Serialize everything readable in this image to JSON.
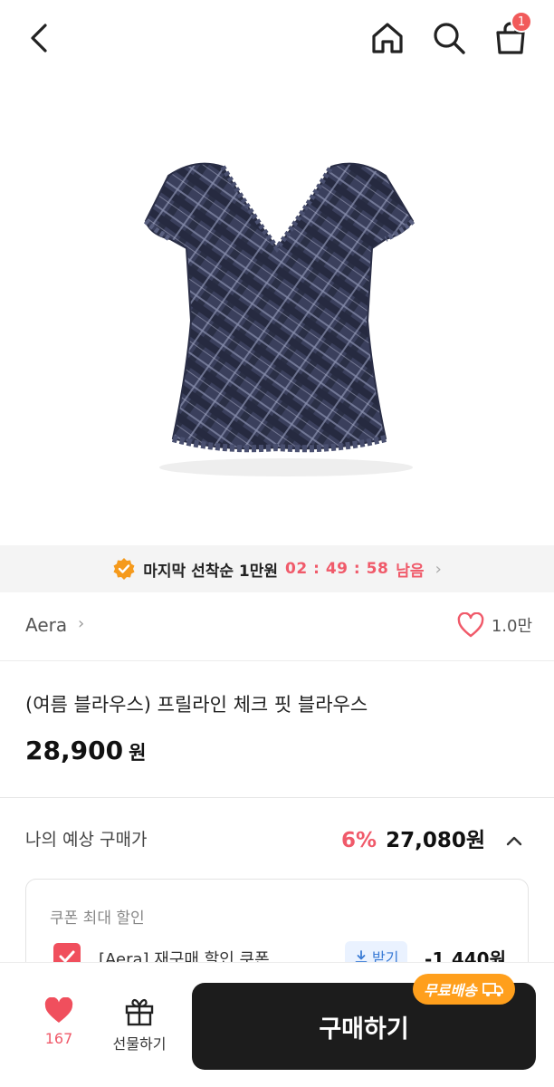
{
  "header": {
    "icons": [
      "back-icon",
      "home-icon",
      "search-icon",
      "cart-icon"
    ],
    "cart_badge": "1"
  },
  "product_image": {
    "alt": "plaid blouse",
    "color": "#3a3f5c"
  },
  "timer": {
    "label": "마지막 선착순 1만원",
    "countdown": "02 : 49 : 58",
    "suffix": "남음",
    "accent": "#f05a6a"
  },
  "brand": {
    "name": "Aera",
    "like_count": "1.0만"
  },
  "product": {
    "title": "(여름 블라우스) 프릴라인 체크 핏 블라우스",
    "price": "28,900",
    "price_unit": "원"
  },
  "expected": {
    "label": "나의 예상 구매가",
    "rate": "6%",
    "price": "27,080원"
  },
  "coupon": {
    "section_title": "쿠폰 최대 할인",
    "name": "[Aera] 재구매 할인 쿠폰",
    "get_label": "받기",
    "discount": "-1,440원"
  },
  "bottom": {
    "wish_count": "167",
    "gift_label": "선물하기",
    "buy_label": "구매하기",
    "free_ship_label": "무료배송"
  }
}
